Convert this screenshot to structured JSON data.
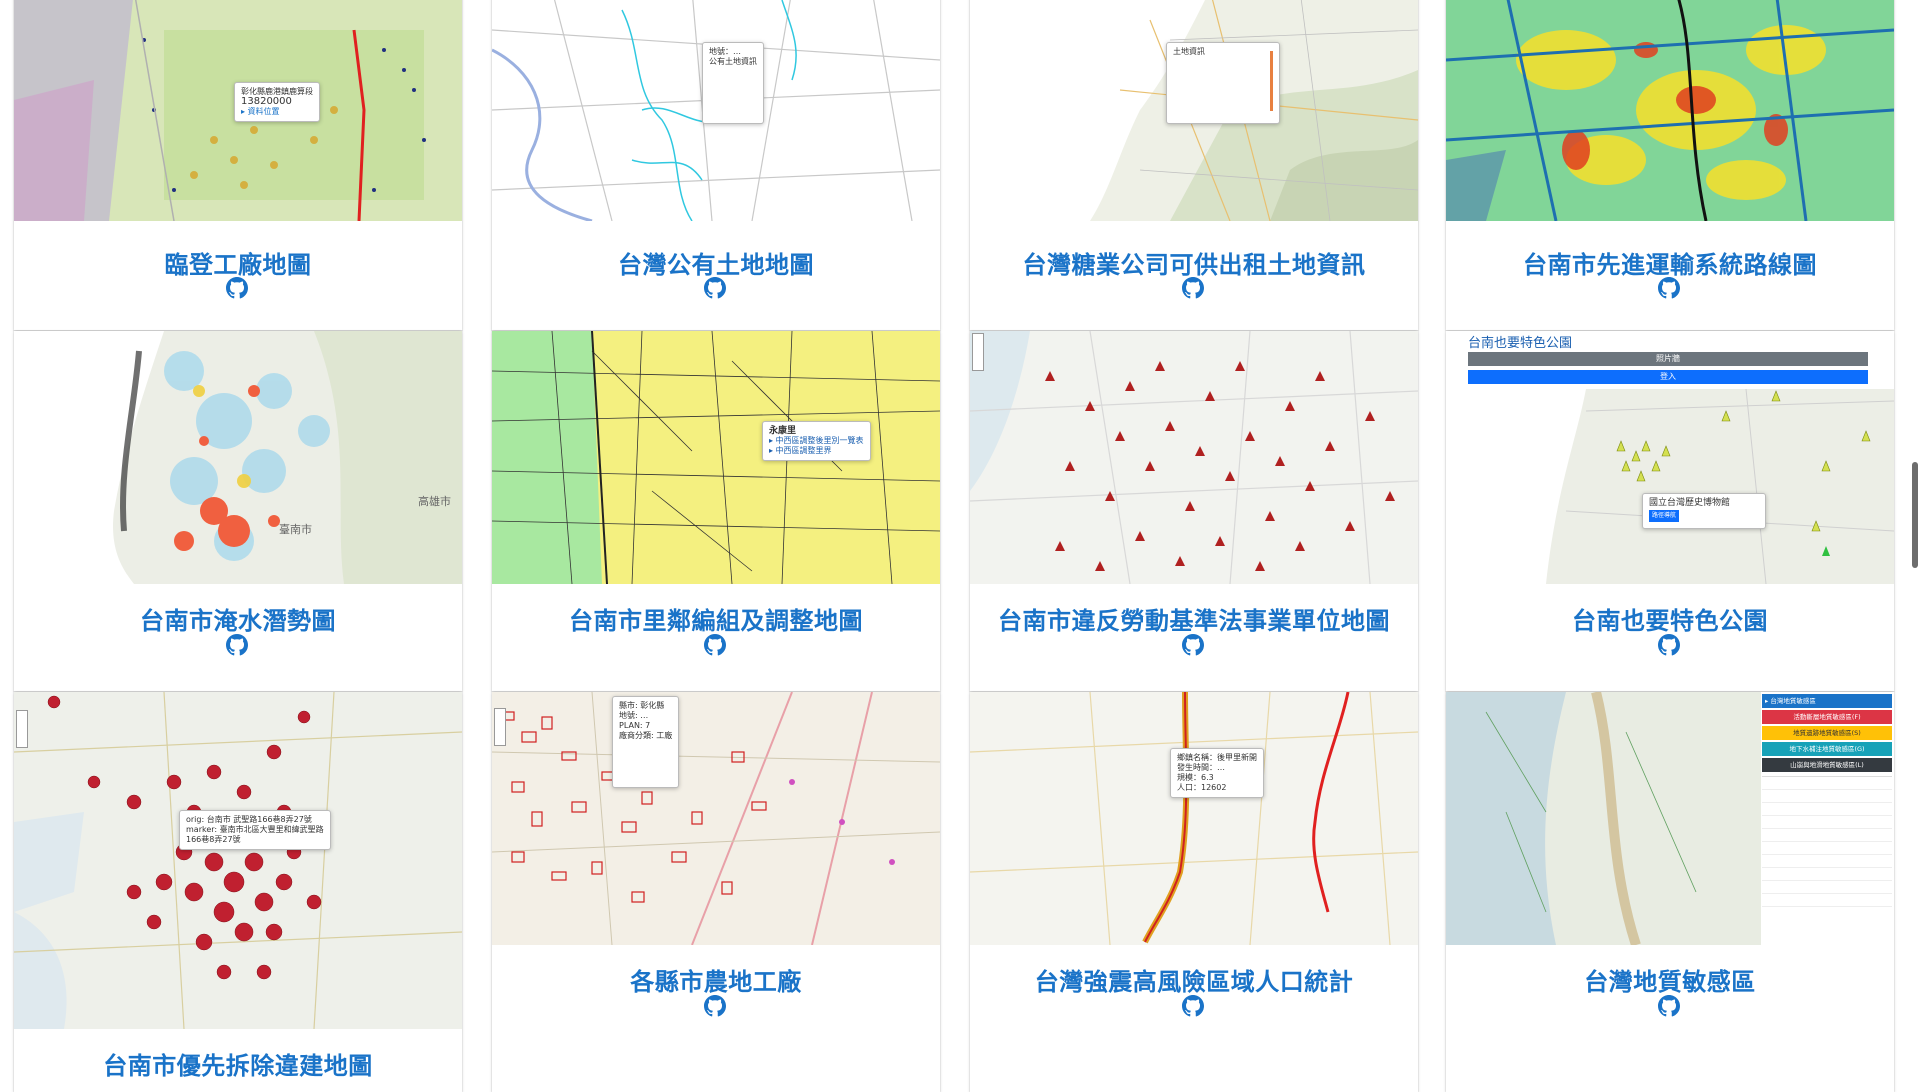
{
  "cards": [
    {
      "title": "臨登工廠地圖",
      "popup": [
        "彰化縣鹿港鎮鹿算段",
        "13820000",
        "▸ 資料位置"
      ]
    },
    {
      "title": "台灣公有土地地圖",
      "popup": [
        "地號：…",
        "公有土地資訊"
      ]
    },
    {
      "title": "台灣糖業公司可供出租土地資訊",
      "popup": [
        "土地資訊"
      ]
    },
    {
      "title": "台南市先進運輸系統路線圖"
    },
    {
      "title": "台南市淹水潛勢圖",
      "labels": [
        "臺南市",
        "高雄市"
      ]
    },
    {
      "title": "台南市里鄰編組及調整地圖",
      "popup": [
        "永康里",
        "▸ 中西區調整後里別一覽表",
        "▸ 中西區調整里界"
      ]
    },
    {
      "title": "台南市違反勞動基準法事業單位地圖"
    },
    {
      "title": "台南也要特色公園",
      "header": "台南也要特色公園",
      "bar1": "照片牆",
      "bar2": "登入",
      "popup": "國立台灣歷史博物館",
      "btn": "路徑導航"
    },
    {
      "title": "台南市優先拆除違建地圖",
      "popup": [
        "orig: 台南市 武聖路166巷8弄27號",
        "marker: 臺南市北區大豐里和緯武聖路",
        "166巷8弄27號"
      ]
    },
    {
      "title": "各縣市農地工廠",
      "popup": [
        "縣市: 彰化縣",
        "地號: …",
        "PLAN: 7",
        "廠商分類: 工廠"
      ]
    },
    {
      "title": "台灣強震高風險區域人口統計",
      "popup": [
        "鄉鎮名稱：後甲里新開",
        "發生時間：…",
        "規模：6.3",
        "人口：12602"
      ]
    },
    {
      "title": "台灣地質敏感區",
      "legend": [
        "▸ 台灣地質敏感區",
        "活動斷層地質敏感區(F)",
        "地質遺跡地質敏感區(S)",
        "地下水補注地質敏感區(G)",
        "山崩與地滑地質敏感區(L)"
      ]
    }
  ],
  "colors": {
    "title": "#1a73c8",
    "card": "#ffffff"
  }
}
